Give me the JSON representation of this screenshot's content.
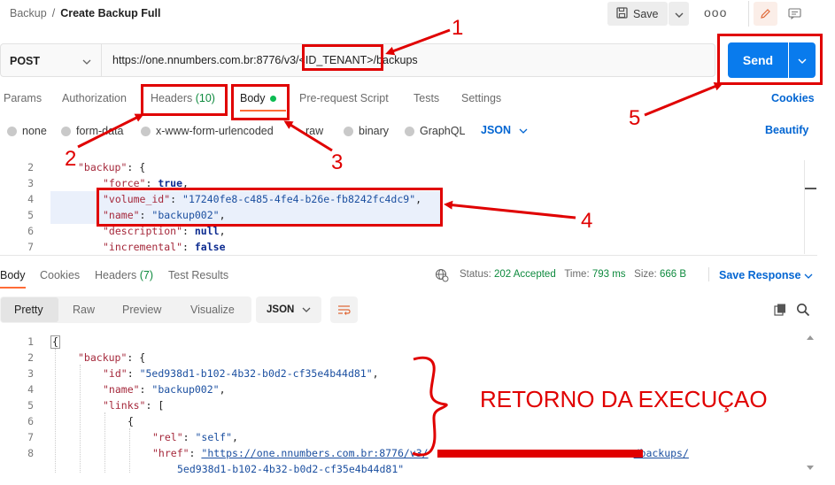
{
  "header": {
    "breadcrumb_parent": "Backup",
    "breadcrumb_separator": "/",
    "title": "Create Backup Full",
    "save_label": "Save",
    "more_label": "ooo"
  },
  "request": {
    "method": "POST",
    "url_prefix": "https://one.nnumbers.com.br:8776/v3/",
    "url_tenant": "<ID_TENANT>",
    "url_suffix": "/backups",
    "send_label": "Send"
  },
  "request_tabs": {
    "params": "Params",
    "authorization": "Authorization",
    "headers": "Headers",
    "headers_count": "(10)",
    "body": "Body",
    "prerequest": "Pre-request Script",
    "tests": "Tests",
    "settings": "Settings",
    "cookies": "Cookies"
  },
  "body_modes": {
    "none": "none",
    "form_data": "form-data",
    "urlencoded": "x-www-form-urlencoded",
    "raw": "raw",
    "binary": "binary",
    "graphql": "GraphQL",
    "language": "JSON",
    "beautify": "Beautify"
  },
  "request_body": {
    "line_numbers": [
      "2",
      "3",
      "4",
      "5",
      "6",
      "7"
    ],
    "key_backup": "\"backup\"",
    "key_force": "\"force\"",
    "val_force": "true",
    "key_volume_id": "\"volume_id\"",
    "val_volume_id": "\"17240fe8-c485-4fe4-b26e-fb8242fc4dc9\"",
    "key_name": "\"name\"",
    "val_name": "\"backup002\"",
    "key_description": "\"description\"",
    "val_description": "null",
    "key_incremental": "\"incremental\"",
    "val_incremental": "false"
  },
  "response_tabs": {
    "body": "Body",
    "cookies": "Cookies",
    "headers": "Headers",
    "headers_count": "(7)",
    "test_results": "Test Results"
  },
  "response_status": {
    "status_label": "Status:",
    "status_value": "202 Accepted",
    "time_label": "Time:",
    "time_value": "793 ms",
    "size_label": "Size:",
    "size_value": "666 B",
    "save_response": "Save Response"
  },
  "response_view": {
    "pretty": "Pretty",
    "raw": "Raw",
    "preview": "Preview",
    "visualize": "Visualize",
    "format": "JSON"
  },
  "response_body": {
    "line_numbers": [
      "1",
      "2",
      "3",
      "4",
      "5",
      "6",
      "7",
      "8"
    ],
    "open_brace": "{",
    "key_backup": "\"backup\"",
    "key_id": "\"id\"",
    "val_id": "\"5ed938d1-b102-4b32-b0d2-cf35e4b44d81\"",
    "key_name": "\"name\"",
    "val_name": "\"backup002\"",
    "key_links": "\"links\"",
    "key_rel": "\"rel\"",
    "val_rel": "\"self\"",
    "key_href": "\"href\"",
    "val_href_start": "\"https://one.nnumbers.com.br:8776/v3/",
    "val_href_end": "/backups/",
    "val_href_cont": "5ed938d1-b102-4b32-b0d2-cf35e4b44d81\""
  },
  "annotations": {
    "n1": "1",
    "n2": "2",
    "n3": "3",
    "n4": "4",
    "n5": "5",
    "retorno": "RETORNO DA EXECUÇAO",
    "color": "#e00000"
  },
  "colors": {
    "send_button": "#097bed",
    "link_blue": "#0265d2",
    "active_tab_underline": "#ff6c37",
    "count_green": "#0e8a3e",
    "json_key": "#a5283b",
    "json_string": "#1b4fa0"
  }
}
